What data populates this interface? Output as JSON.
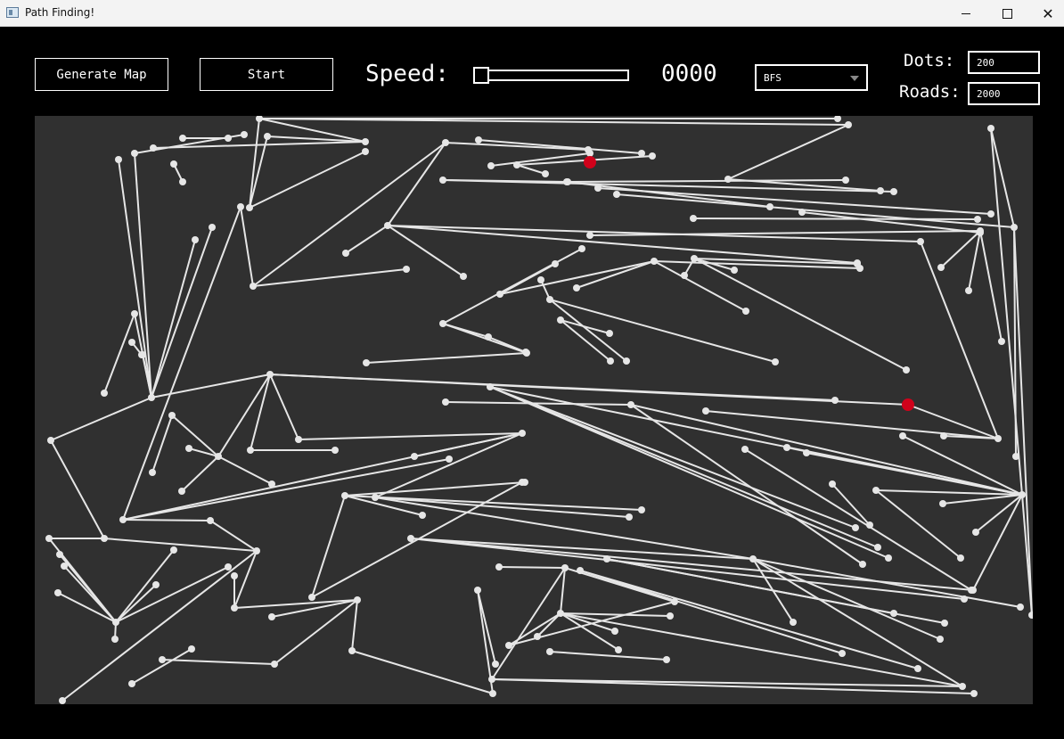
{
  "window": {
    "title": "Path Finding!"
  },
  "toolbar": {
    "generate_label": "Generate Map",
    "start_label": "Start",
    "speed_label": "Speed:",
    "speed_value": "0000",
    "algorithm": {
      "selected": "BFS"
    },
    "dots_label": "Dots:",
    "dots_value": "200",
    "roads_label": "Roads:",
    "roads_value": "2000"
  },
  "map": {
    "background": "#303030",
    "road_color": "#e6e6e6",
    "endpoint_color": "#d0021b"
  }
}
